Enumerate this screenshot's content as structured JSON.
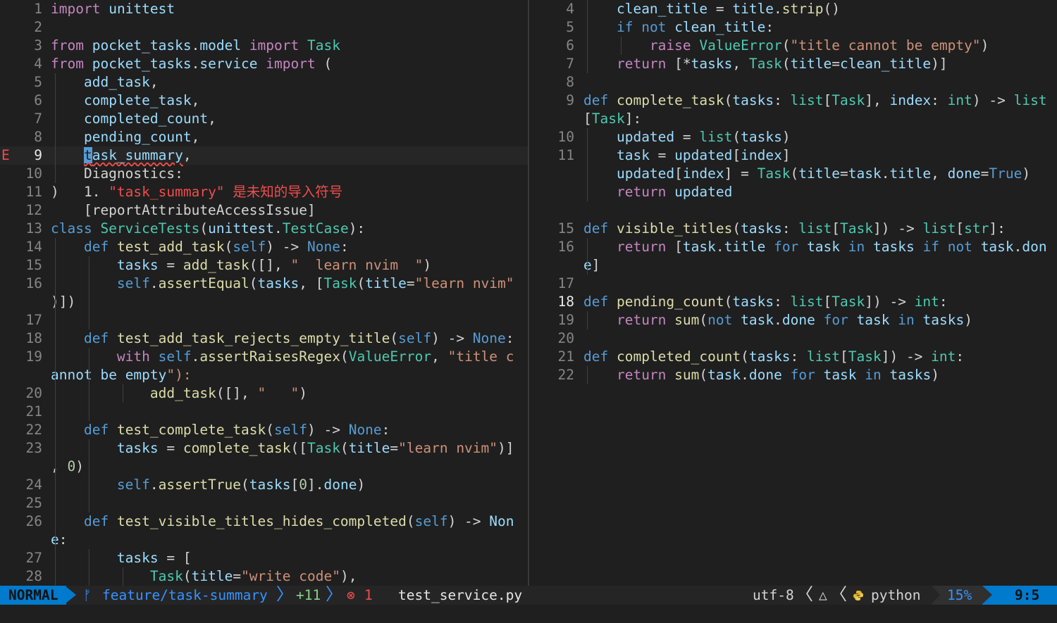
{
  "editor": {
    "left_file": "test_service.py",
    "right_file": "service.py",
    "left_lines": [
      {
        "n": "1",
        "text": "import unittest"
      },
      {
        "n": "2",
        "text": ""
      },
      {
        "n": "3",
        "text": "from pocket_tasks.model import Task"
      },
      {
        "n": "4",
        "text": "from pocket_tasks.service import ("
      },
      {
        "n": "5",
        "text": "    add_task,"
      },
      {
        "n": "6",
        "text": "    complete_task,"
      },
      {
        "n": "7",
        "text": "    completed_count,"
      },
      {
        "n": "8",
        "text": "    pending_count,"
      },
      {
        "n": "9",
        "text": "    task_summary,",
        "sign": "E",
        "current": true
      },
      {
        "n": "10",
        "text": "    Diagnostics:"
      },
      {
        "n": "11",
        "text": ")   1. \"task_summary\" 是未知的导入符号"
      },
      {
        "n": "12",
        "text": "    [reportAttributeAccessIssue]"
      },
      {
        "n": "13",
        "text": "class ServiceTests(unittest.TestCase):"
      },
      {
        "n": "14",
        "text": "    def test_add_task(self) -> None:"
      },
      {
        "n": "15",
        "text": "        tasks = add_task([], \"  learn nvim  \")"
      },
      {
        "n": "16",
        "text": "        self.assertEqual(tasks, [Task(title=\"learn nvim\""
      },
      {
        "n": "",
        "text": ")])"
      },
      {
        "n": "17",
        "text": ""
      },
      {
        "n": "18",
        "text": "    def test_add_task_rejects_empty_title(self) -> None:"
      },
      {
        "n": "19",
        "text": "        with self.assertRaisesRegex(ValueError, \"title c"
      },
      {
        "n": "",
        "text": "annot be empty\"):"
      },
      {
        "n": "20",
        "text": "            add_task([], \"   \")"
      },
      {
        "n": "21",
        "text": ""
      },
      {
        "n": "22",
        "text": "    def test_complete_task(self) -> None:"
      },
      {
        "n": "23",
        "text": "        tasks = complete_task([Task(title=\"learn nvim\")]"
      },
      {
        "n": "",
        "text": ", 0)"
      },
      {
        "n": "24",
        "text": "        self.assertTrue(tasks[0].done)"
      },
      {
        "n": "25",
        "text": ""
      },
      {
        "n": "26",
        "text": "    def test_visible_titles_hides_completed(self) -> Non"
      },
      {
        "n": "",
        "text": "e:"
      },
      {
        "n": "27",
        "text": "        tasks = ["
      },
      {
        "n": "28",
        "text": "            Task(title=\"write code\"),"
      }
    ],
    "right_lines": [
      {
        "n": "4",
        "text": "    clean_title = title.strip()"
      },
      {
        "n": "5",
        "text": "    if not clean_title:"
      },
      {
        "n": "6",
        "text": "        raise ValueError(\"title cannot be empty\")"
      },
      {
        "n": "7",
        "text": "    return [*tasks, Task(title=clean_title)]"
      },
      {
        "n": "8",
        "text": ""
      },
      {
        "n": "9",
        "text": "def complete_task(tasks: list[Task], index: int) -> list"
      },
      {
        "n": "",
        "text": "[Task]:"
      },
      {
        "n": "10",
        "text": "    updated = list(tasks)"
      },
      {
        "n": "11",
        "text": "    task = updated[index]"
      },
      {
        "n": "",
        "text": "    updated[index] = Task(title=task.title, done=True)"
      },
      {
        "n": "",
        "text": "    return updated"
      },
      {
        "n": "",
        "text": ""
      },
      {
        "n": "15",
        "text": "def visible_titles(tasks: list[Task]) -> list[str]:"
      },
      {
        "n": "16",
        "text": "    return [task.title for task in tasks if not task.don"
      },
      {
        "n": "",
        "text": "e]"
      },
      {
        "n": "17",
        "text": ""
      },
      {
        "n": "18",
        "text": "def pending_count(tasks: list[Task]) -> int:",
        "current": true
      },
      {
        "n": "19",
        "text": "    return sum(not task.done for task in tasks)"
      },
      {
        "n": "20",
        "text": ""
      },
      {
        "n": "21",
        "text": "def completed_count(tasks: list[Task]) -> int:"
      },
      {
        "n": "22",
        "text": "    return sum(task.done for task in tasks)"
      }
    ]
  },
  "statusline": {
    "mode": "NORMAL",
    "branch_icon": "git-branch-icon",
    "branch": "feature/task-summary",
    "added": "+11",
    "error_icon": "error-circle-icon",
    "errors": "1",
    "filename": "test_service.py",
    "encoding": "utf-8",
    "os_icon": "linux-icon",
    "filetype_icon": "python-icon",
    "filetype": "python",
    "percent": "15%",
    "position": "9:5"
  },
  "colors": {
    "background": "#1f1f1f",
    "keyword_purple": "#c586c0",
    "keyword_blue": "#569cd6",
    "function": "#dcdcaa",
    "type": "#4ec9b0",
    "string": "#ce9178",
    "number": "#b5cea8",
    "variable": "#9cdcfe",
    "error": "#f14c4c",
    "mode_bg": "#007acc"
  }
}
